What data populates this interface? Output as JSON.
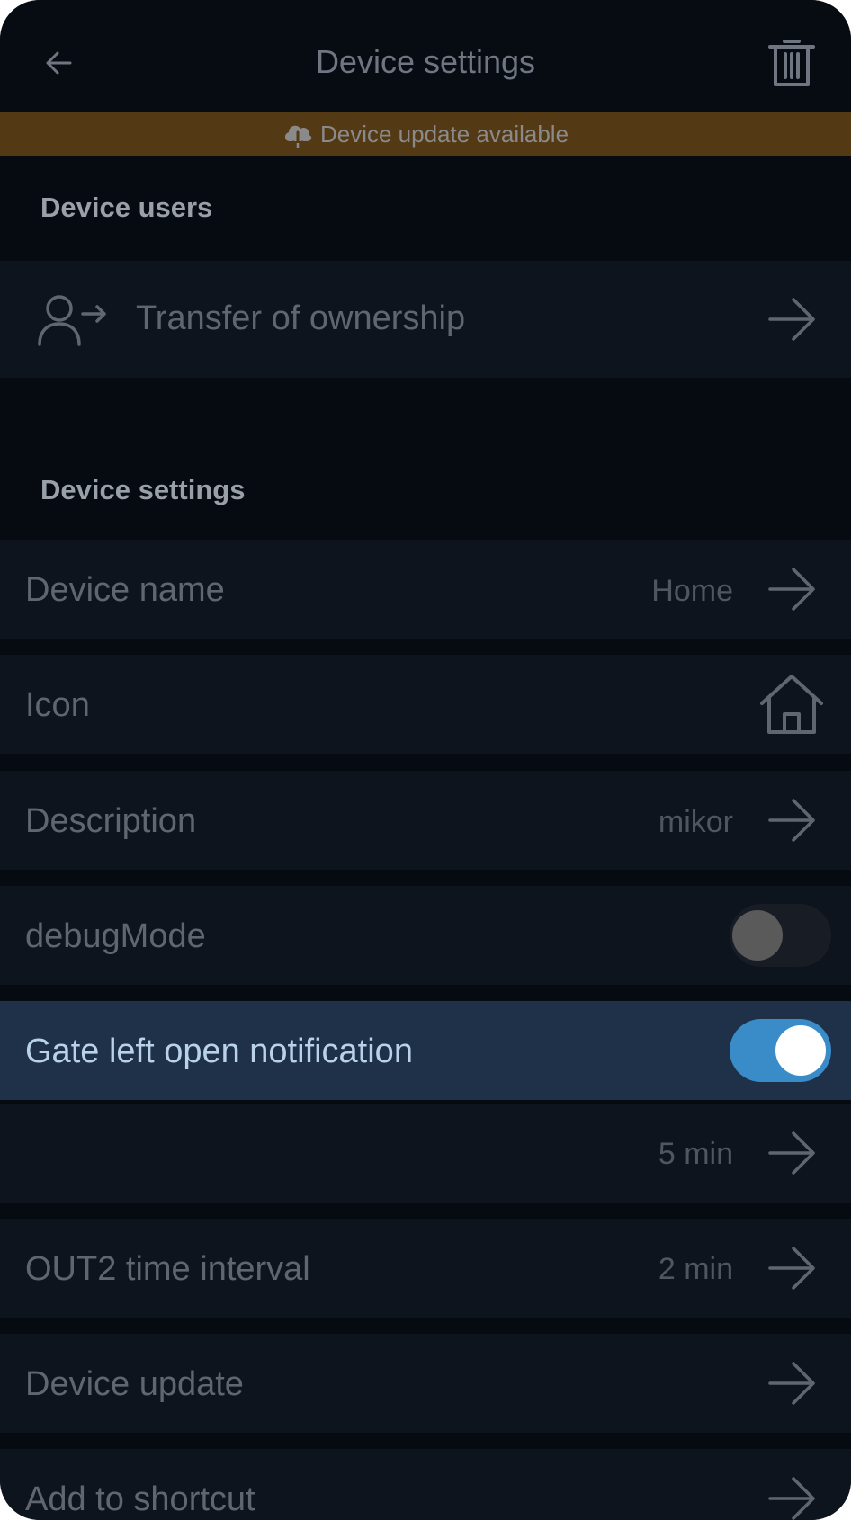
{
  "header": {
    "title": "Device settings",
    "back_icon": "arrow-left-icon",
    "delete_icon": "trash-icon"
  },
  "banner": {
    "text": "Device update available",
    "icon": "cloud-download-icon"
  },
  "sections": {
    "users_title": "Device users",
    "settings_title": "Device settings"
  },
  "users": {
    "transfer_label": "Transfer of ownership",
    "transfer_icon": "user-transfer-icon"
  },
  "settings": {
    "device_name_label": "Device name",
    "device_name_value": "Home",
    "icon_label": "Icon",
    "icon_value": "home-icon",
    "description_label": "Description",
    "description_value": "mikor",
    "debug_label": "debugMode",
    "debug_on": false,
    "gate_label": "Gate left open notification",
    "gate_on": true,
    "gate_interval_value": "5 min",
    "out2_label": "OUT2 time interval",
    "out2_value": "2 min",
    "update_label": "Device update",
    "shortcut_label": "Add to shortcut"
  },
  "colors": {
    "background": "#060b12",
    "row": "#0e141e",
    "highlight_row": "#1e3149",
    "banner": "#533a14",
    "toggle_on": "#3a8cc8"
  }
}
